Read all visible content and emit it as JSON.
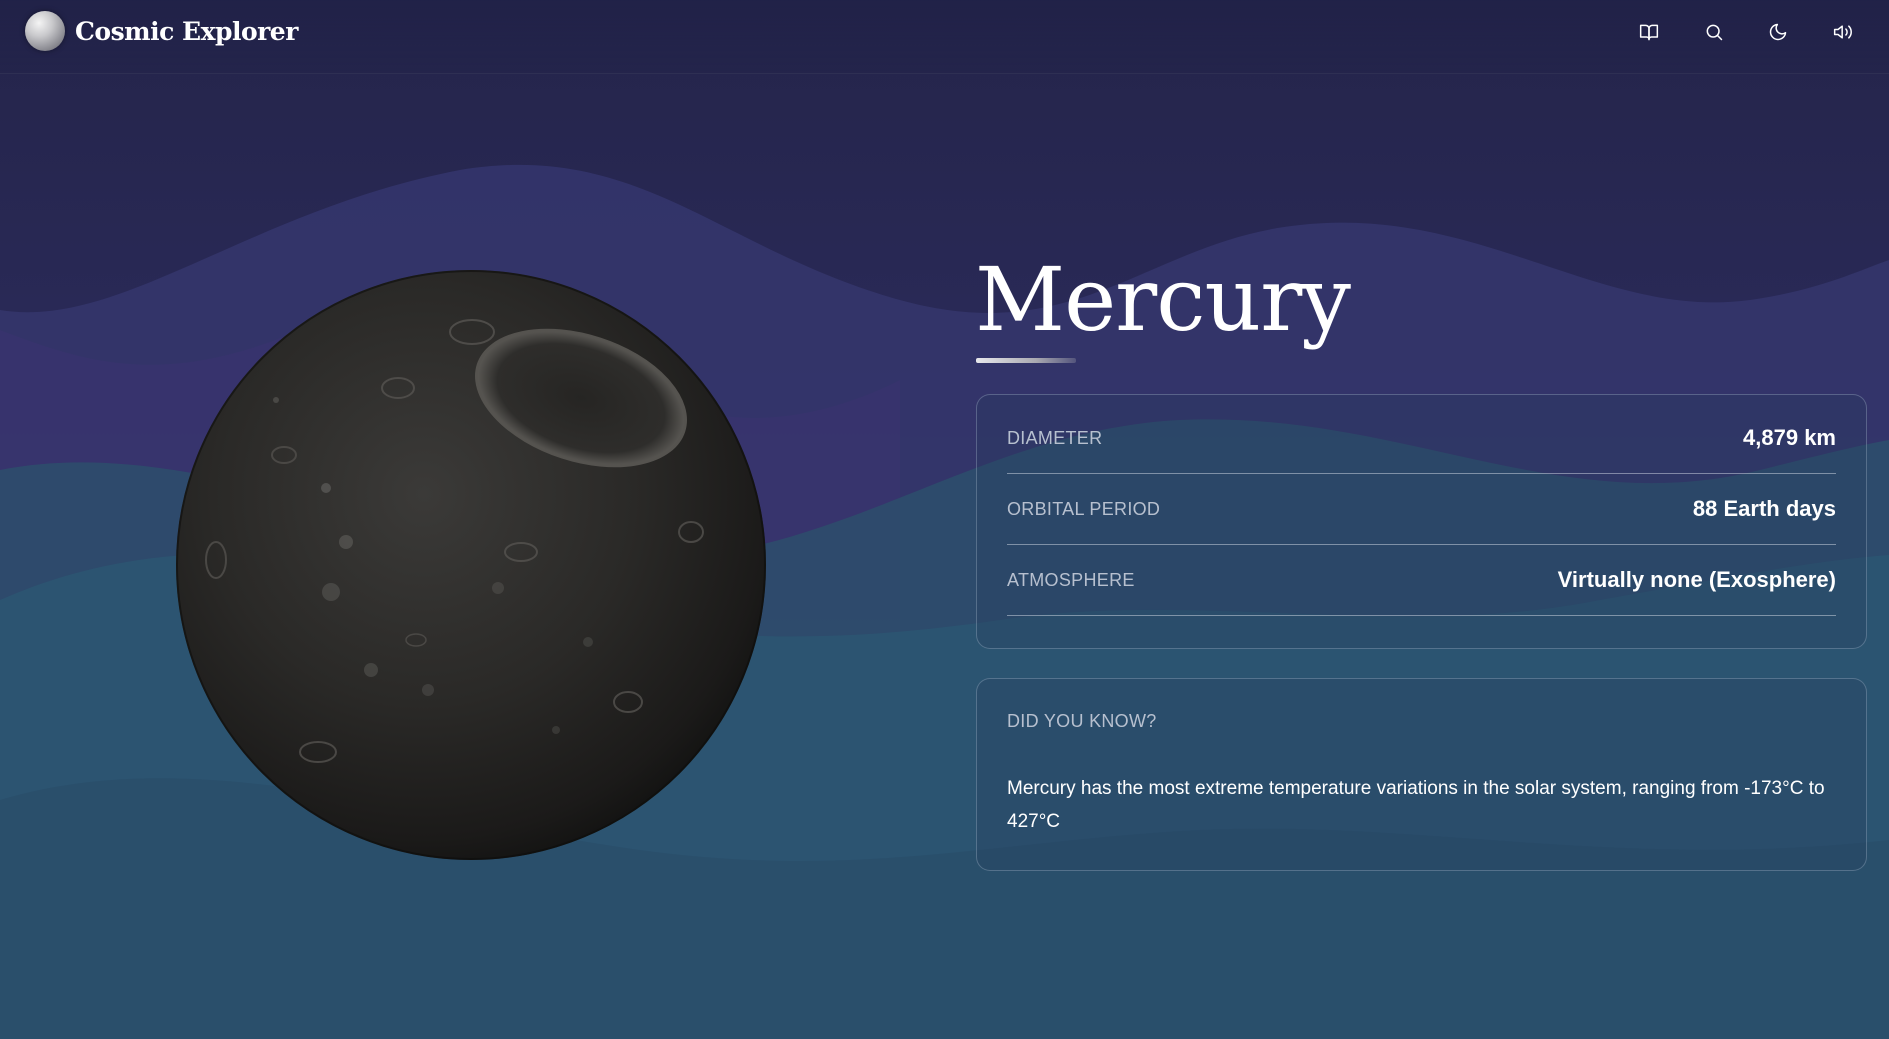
{
  "header": {
    "brand_name": "Cosmic Explorer",
    "actions": [
      {
        "name": "book-icon",
        "label": ""
      },
      {
        "name": "search-icon",
        "label": ""
      },
      {
        "name": "moon-icon",
        "label": ""
      },
      {
        "name": "volume-icon",
        "label": ""
      }
    ]
  },
  "planet": {
    "name": "Mercury"
  },
  "stats": [
    {
      "label": "DIAMETER",
      "value": "4,879 km"
    },
    {
      "label": "ORBITAL PERIOD",
      "value": "88 Earth days"
    },
    {
      "label": "ATMOSPHERE",
      "value": "Virtually none (Exosphere)"
    }
  ],
  "fact": {
    "heading": "DID YOU KNOW?",
    "text": "Mercury has the most extreme temperature variations in the solar system, ranging from -173°C to 427°C"
  },
  "colors": {
    "background_top": "#2b2a55",
    "background_bottom": "#2a4a66",
    "wave_purple": "#3a3a72",
    "wave_teal": "#2b5470",
    "text_primary": "#ffffff",
    "text_muted": "#b7c0cf",
    "card_border": "#5a6b85"
  }
}
